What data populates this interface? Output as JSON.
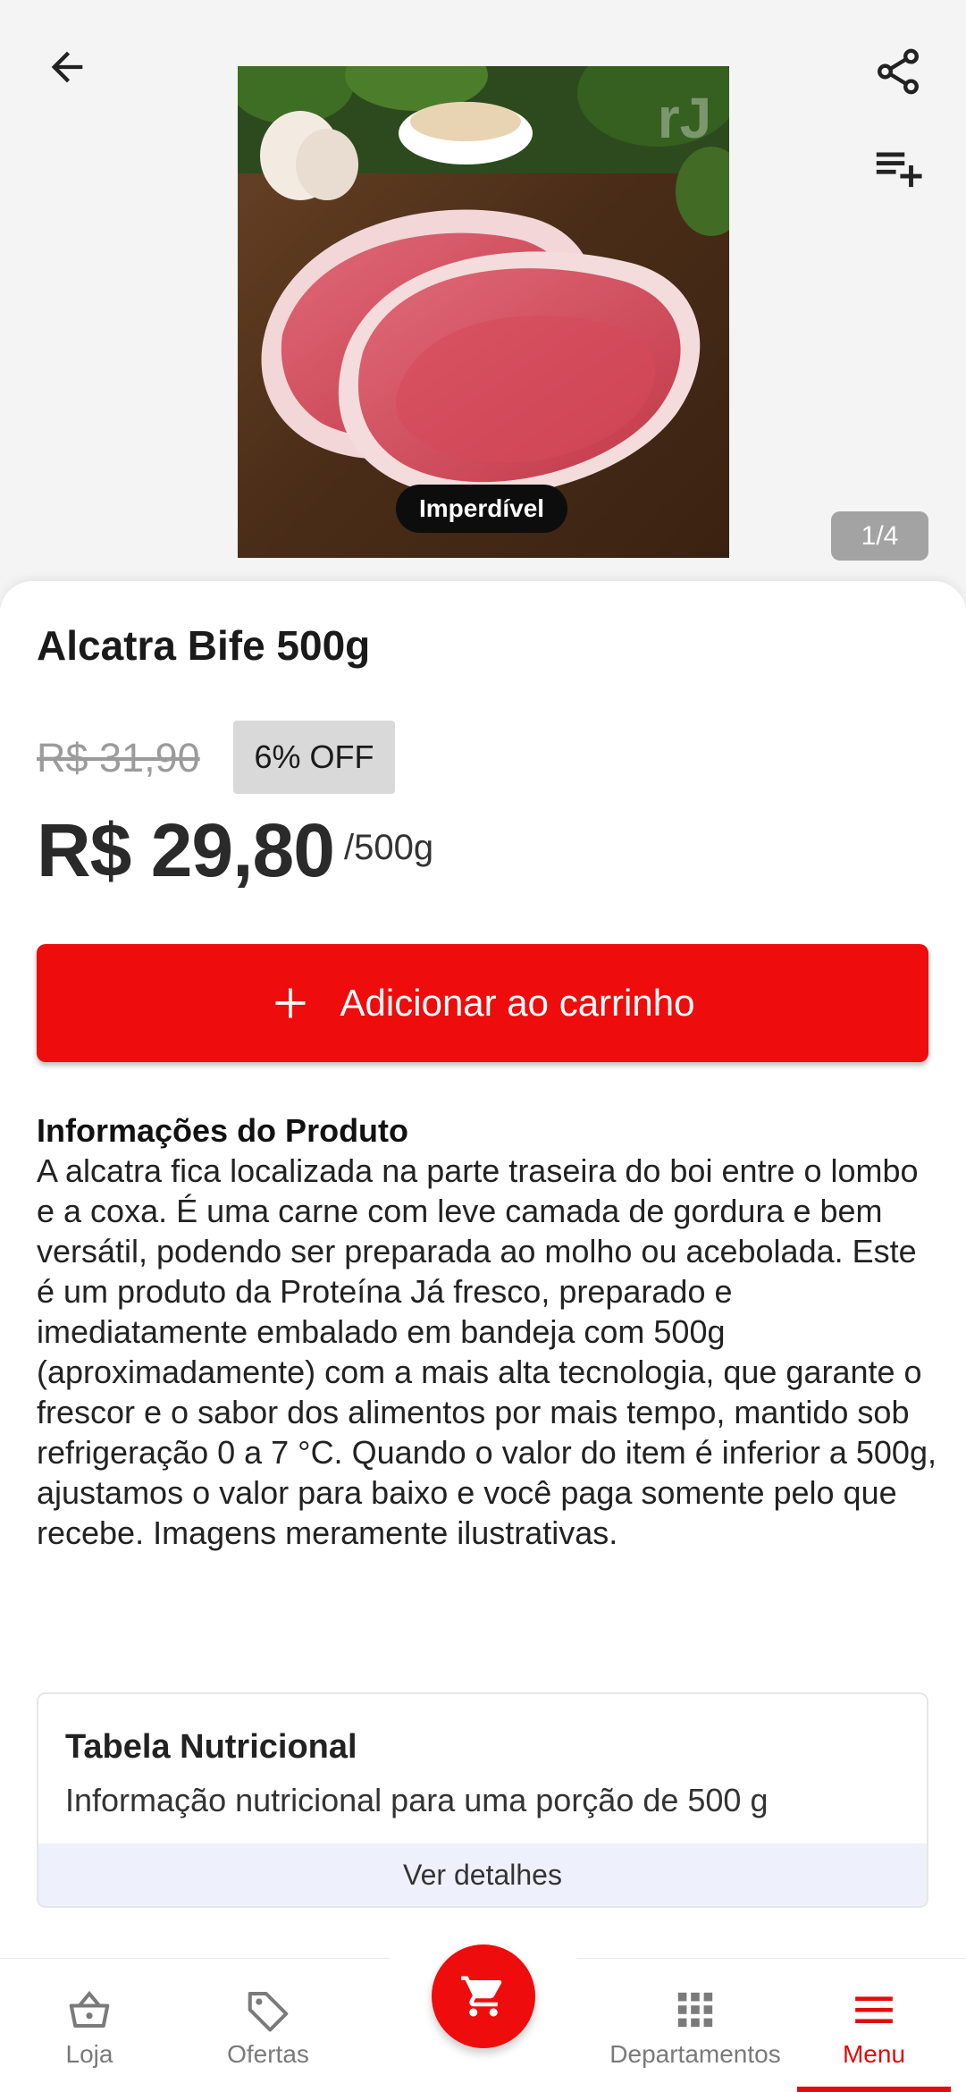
{
  "header": {
    "image_badge": "Imperdível",
    "image_counter": "1/4",
    "icons": [
      "arrow-back-icon",
      "share-icon",
      "playlist-add-icon"
    ]
  },
  "product": {
    "title": "Alcatra Bife 500g",
    "old_price": "R$ 31,90",
    "discount": "6% OFF",
    "price": "R$ 29,80",
    "unit": "/500g"
  },
  "add_to_cart": {
    "label": "Adicionar ao carrinho"
  },
  "info": {
    "heading": "Informações do Produto",
    "body": "A alcatra fica localizada na parte traseira do boi entre o lombo e a coxa. É uma carne com leve camada de gordura e bem versátil, podendo ser preparada ao molho ou acebolada. Este é um produto da Proteína Já fresco, preparado e imediatamente embalado em bandeja com 500g (aproximadamente) com a mais alta tecnologia, que garante o frescor e o sabor dos alimentos por mais tempo, mantido sob refrigeração 0 a 7 °C. Quando o valor do item é inferior a 500g, ajustamos o valor para baixo e você paga somente pelo que recebe. Imagens meramente ilustrativas."
  },
  "nutrition": {
    "title": "Tabela Nutricional",
    "subtitle": "Informação nutricional para uma porção de 500 g",
    "details_label": "Ver detalhes"
  },
  "bottom_nav": {
    "loja": "Loja",
    "ofertas": "Ofertas",
    "departamentos": "Departamentos",
    "menu": "Menu",
    "active": "Menu"
  },
  "colors": {
    "accent_red": "#ee0c0c",
    "nav_active": "#e30b0b",
    "discount_bg": "#d9d9d9"
  }
}
